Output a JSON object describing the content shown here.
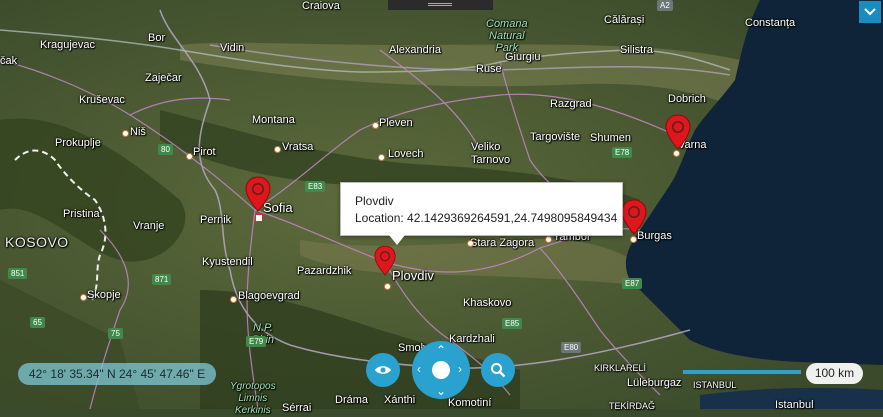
{
  "colors": {
    "accent": "#2aa2cf",
    "pin": "#e0161d",
    "sea": "#0f2438"
  },
  "popup": {
    "title": "Plovdiv",
    "location": "Location: 42.1429369264591,24.7498095849434"
  },
  "coordinates_readout": "42° 18' 35.34\" N 24° 45' 47.46\" E",
  "scale_label": "100 km",
  "controls": {
    "eye": "eye-icon",
    "pad": "directional-pad-icon",
    "search": "magnifier-icon",
    "collapse": "chevron-down-icon"
  },
  "pins": [
    "Sofia",
    "Plovdiv",
    "Varna",
    "Burgas"
  ],
  "places": {
    "craiova": "Craiova",
    "calarasi": "Călărași",
    "constanta": "Constanța",
    "kragujevac": "Kragujevac",
    "bor": "Bor",
    "vidin": "Vidin",
    "alexandria": "Alexandria",
    "giurgiu": "Giurgiu",
    "silistra": "Silistra",
    "ruse": "Ruse",
    "zajecar": "Zaječar",
    "krusevac": "Kruševac",
    "montana": "Montana",
    "pleven": "Pleven",
    "razgrad": "Razgrad",
    "dobrich": "Dobrich",
    "nis": "Niš",
    "prokuplje": "Prokuplje",
    "pirot": "Pirot",
    "vratsa": "Vratsa",
    "lovech": "Lovech",
    "veliko_tarnovo_1": "Veliko",
    "veliko_tarnovo_2": "Tarnovo",
    "targoviste": "Targovište",
    "shumen": "Shumen",
    "varna": "Varna",
    "sofia": "Sofia",
    "pristina": "Pristina",
    "pernik": "Pernik",
    "vranje": "Vranje",
    "yambol": "Yambol",
    "burgas": "Burgas",
    "stara_zagora": "Stara Zagora",
    "kosovo": "KOSOVO",
    "kyustendil": "Kyustendil",
    "pazardzhik": "Pazardzhik",
    "plovdiv": "Plovdiv",
    "skopje": "Skopje",
    "blagoevgrad": "Blagoevgrad",
    "khaskovo": "Khaskovo",
    "smolyan": "Smolyan",
    "kardzhali": "Kardzhali",
    "kirklareli": "KIRKLARELİ",
    "luleburgaz": "Lüleburgaz",
    "istanbul": "ISTANBUL",
    "tekirdag": "TEKİRDAĞ",
    "istanbul_city": "Istanbul",
    "drama": "Dráma",
    "xanthi": "Xánthi",
    "komotini": "Komotiní",
    "serrai": "Sérrai",
    "park1_a": "Comana",
    "park1_b": "Natural",
    "park1_c": "Park",
    "park2_a": "N.P.",
    "park2_b": "Pirin",
    "park3_a": "Ygrotopos",
    "park3_b": "Limnis",
    "park3_c": "Kerkinis",
    "cak": "čak"
  },
  "roads": {
    "e80": "80",
    "e83": "E83",
    "e871": "871",
    "e851": "851",
    "e75": "75",
    "e65": "65",
    "e79": "E79",
    "e85": "E85",
    "e87": "E87",
    "e80b": "E80",
    "e70": "E70",
    "a2": "A2",
    "e78": "E78"
  }
}
